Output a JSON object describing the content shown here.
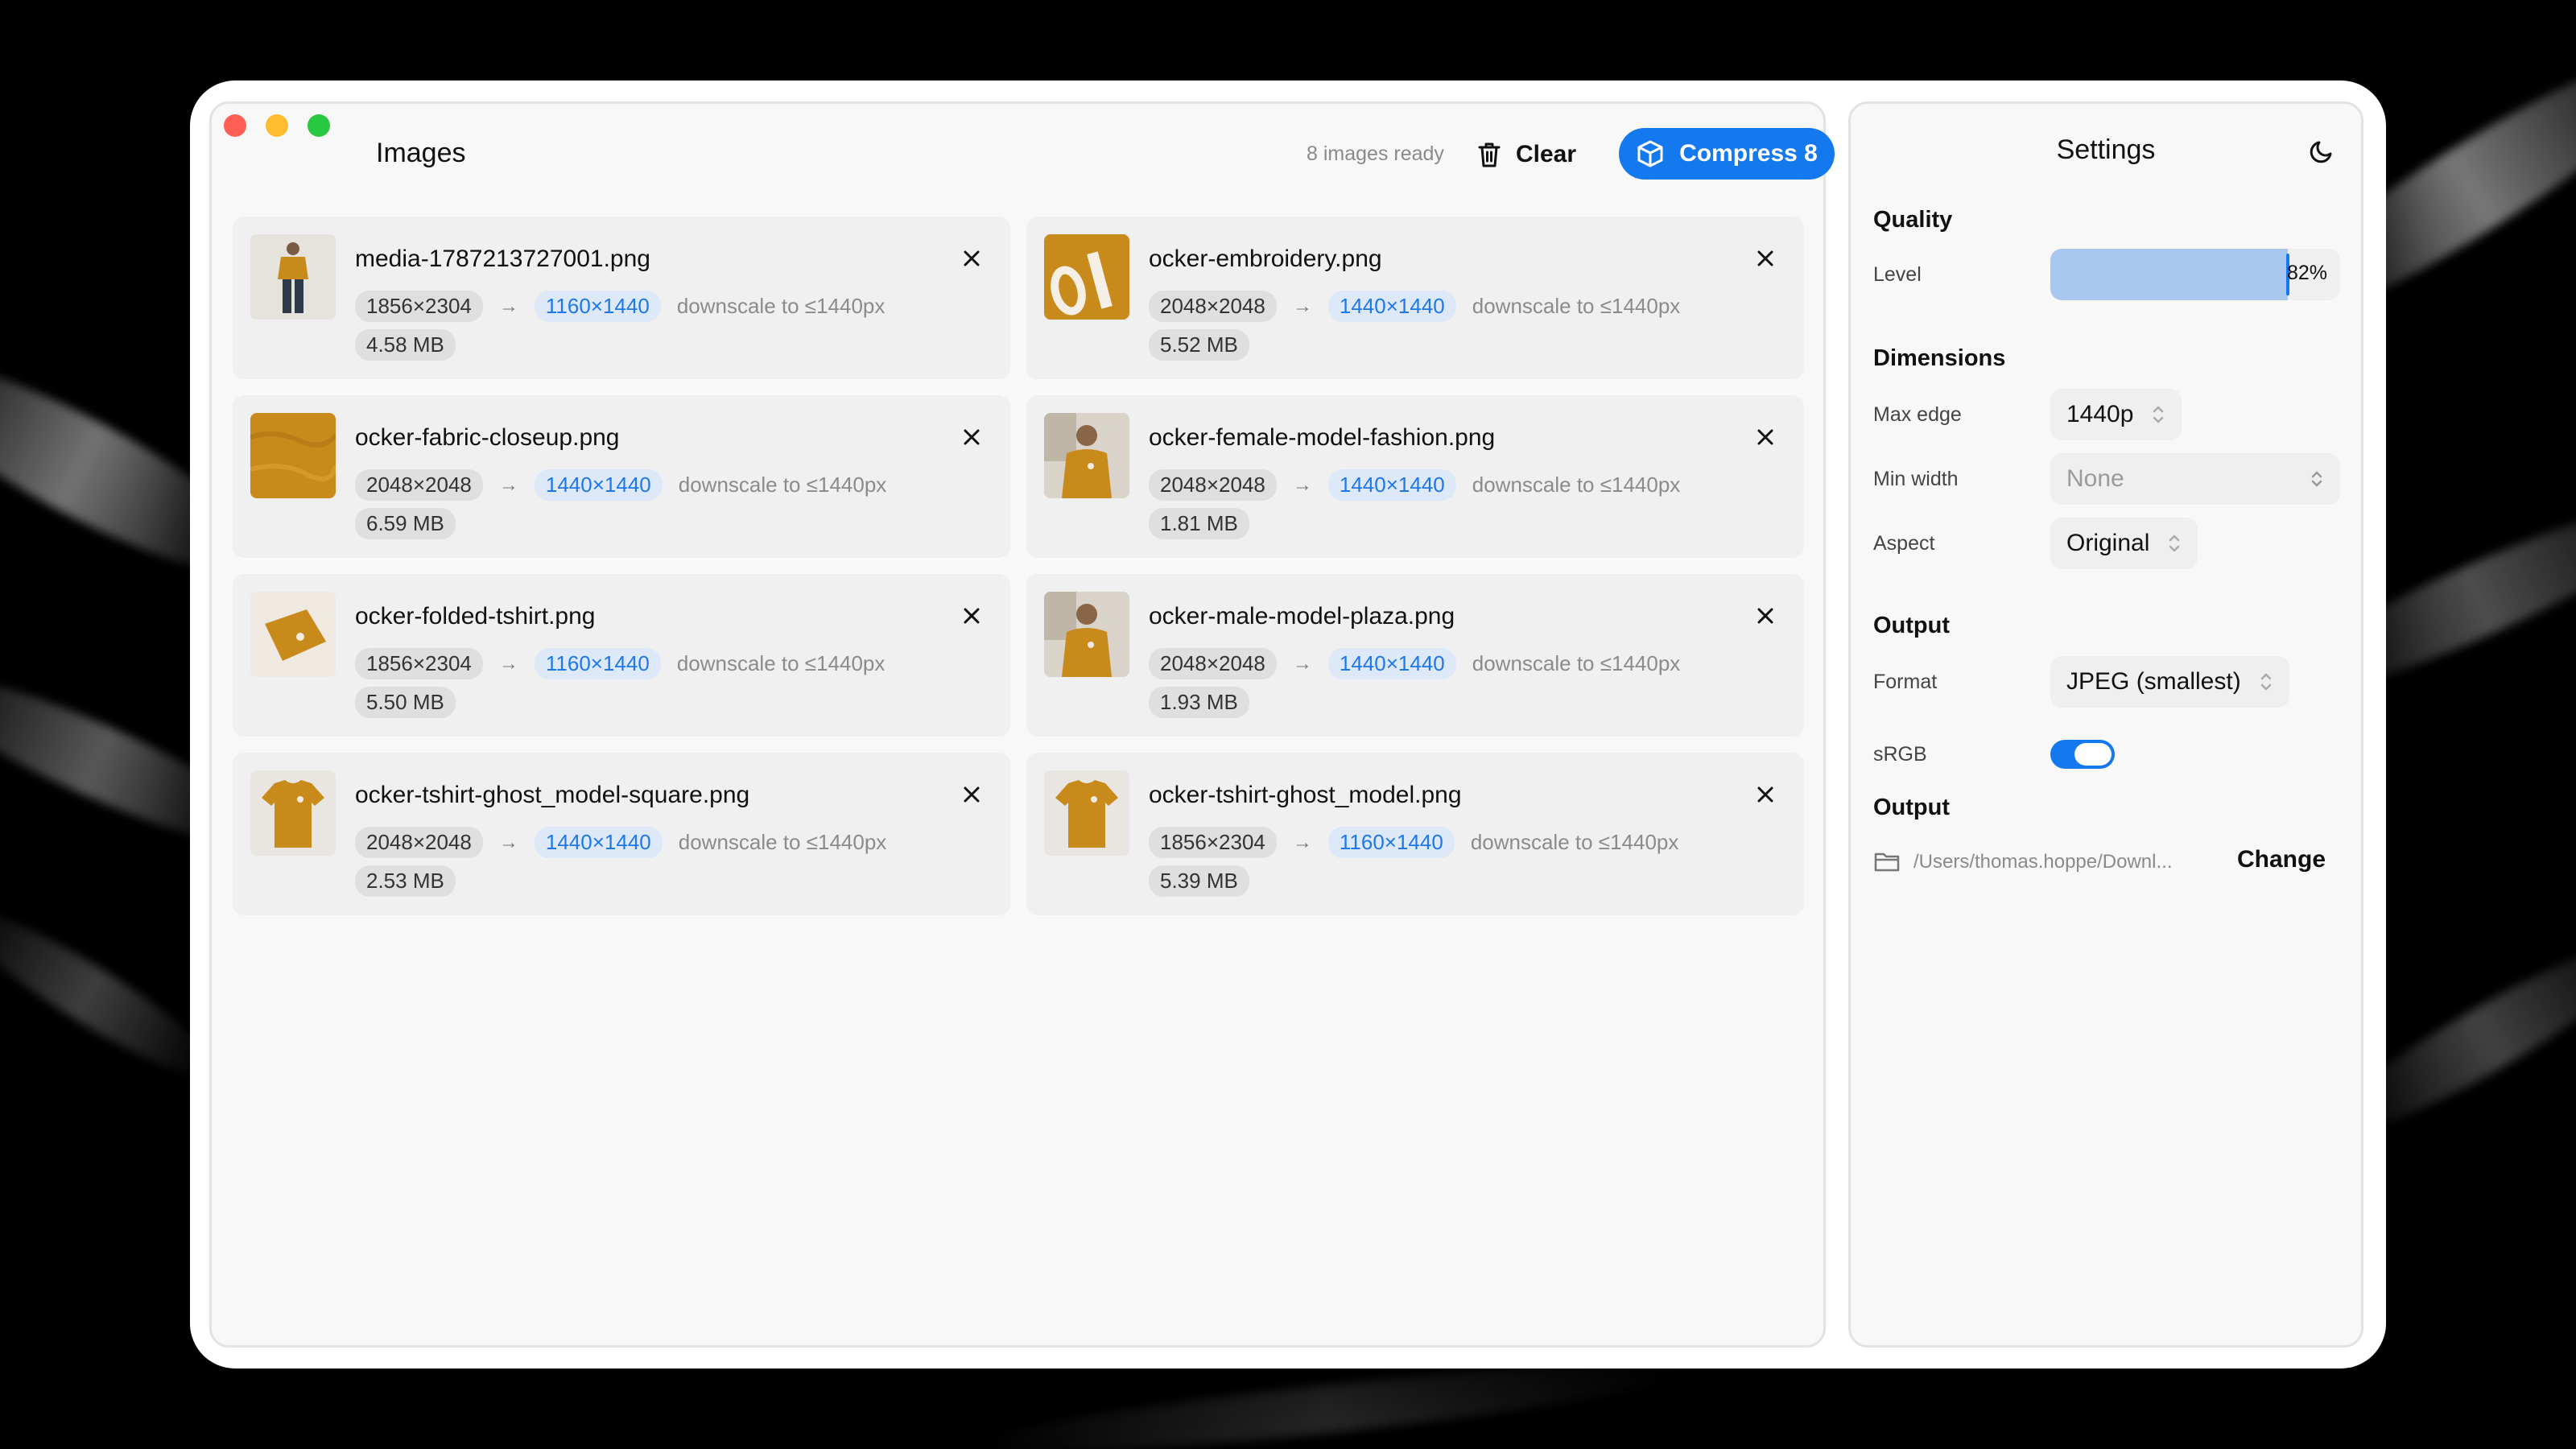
{
  "main": {
    "title": "Images",
    "status": "8 images ready",
    "clear_label": "Clear",
    "compress_label": "Compress 8"
  },
  "images": [
    {
      "name": "media-1787213727001.png",
      "orig": "1856×2304",
      "target": "1160×1440",
      "note": "downscale to ≤1440px",
      "size": "4.58 MB",
      "thumb": "person-standing"
    },
    {
      "name": "ocker-embroidery.png",
      "orig": "2048×2048",
      "target": "1440×1440",
      "note": "downscale to ≤1440px",
      "size": "5.52 MB",
      "thumb": "logo-closeup"
    },
    {
      "name": "ocker-fabric-closeup.png",
      "orig": "2048×2048",
      "target": "1440×1440",
      "note": "downscale to ≤1440px",
      "size": "6.59 MB",
      "thumb": "fabric"
    },
    {
      "name": "ocker-female-model-fashion.png",
      "orig": "2048×2048",
      "target": "1440×1440",
      "note": "downscale to ≤1440px",
      "size": "1.81 MB",
      "thumb": "model"
    },
    {
      "name": "ocker-folded-tshirt.png",
      "orig": "1856×2304",
      "target": "1160×1440",
      "note": "downscale to ≤1440px",
      "size": "5.50 MB",
      "thumb": "folded"
    },
    {
      "name": "ocker-male-model-plaza.png",
      "orig": "2048×2048",
      "target": "1440×1440",
      "note": "downscale to ≤1440px",
      "size": "1.93 MB",
      "thumb": "model"
    },
    {
      "name": "ocker-tshirt-ghost_model-square.png",
      "orig": "2048×2048",
      "target": "1440×1440",
      "note": "downscale to ≤1440px",
      "size": "2.53 MB",
      "thumb": "tshirt"
    },
    {
      "name": "ocker-tshirt-ghost_model.png",
      "orig": "1856×2304",
      "target": "1160×1440",
      "note": "downscale to ≤1440px",
      "size": "5.39 MB",
      "thumb": "tshirt"
    }
  ],
  "settings": {
    "title": "Settings",
    "quality_heading": "Quality",
    "level_label": "Level",
    "level_value": "82%",
    "level_fraction": 0.82,
    "dimensions_heading": "Dimensions",
    "max_edge_label": "Max edge",
    "max_edge_value": "1440p",
    "min_width_label": "Min width",
    "min_width_placeholder": "None",
    "aspect_label": "Aspect",
    "aspect_value": "Original",
    "output_heading": "Output",
    "format_label": "Format",
    "format_value": "JPEG (smallest)",
    "srgb_label": "sRGB",
    "srgb_on": true,
    "output_dir_heading": "Output",
    "output_path": "/Users/thomas.hoppe/Downl...",
    "change_label": "Change"
  },
  "colors": {
    "accent": "#1479ef",
    "target_pill_bg": "#dde9f8",
    "target_pill_text": "#1e78e8",
    "thumb_ochre": "#c98a1c"
  }
}
